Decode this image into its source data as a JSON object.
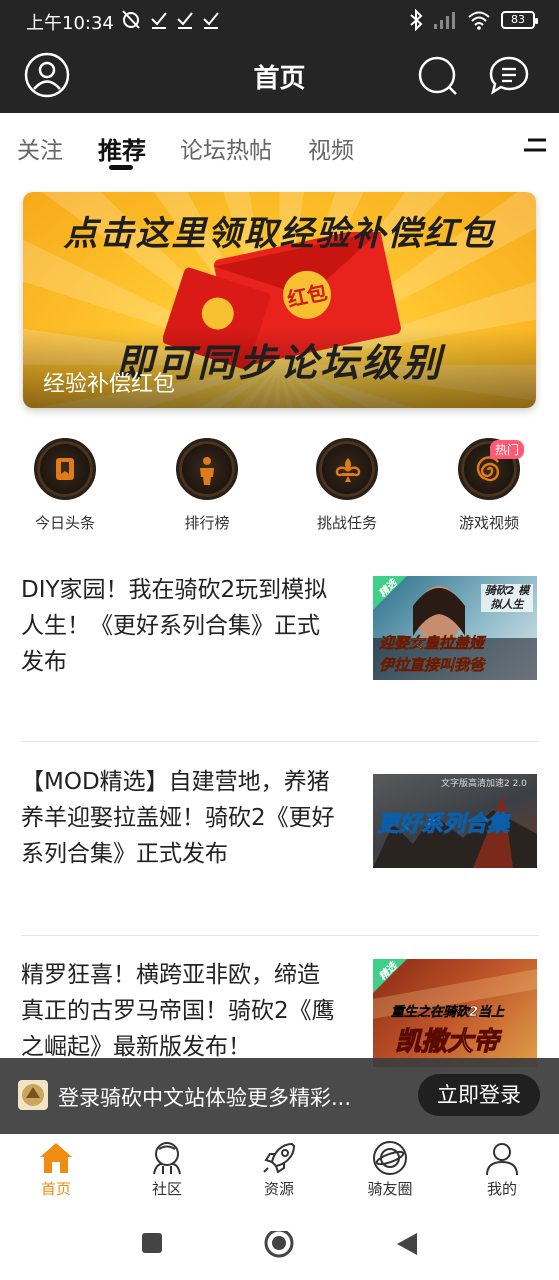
{
  "status_bar": {
    "time": "上午10:34",
    "battery": "83"
  },
  "header": {
    "title": "首页"
  },
  "tabs": [
    {
      "label": "关注",
      "active": false
    },
    {
      "label": "推荐",
      "active": true
    },
    {
      "label": "论坛热帖",
      "active": false
    },
    {
      "label": "视频",
      "active": false
    }
  ],
  "banner": {
    "line1": "点击这里领取经验补偿红包",
    "envelope_text": "红包",
    "line2": "即可同步论坛级别",
    "caption": "经验补偿红包"
  },
  "quick_links": [
    {
      "label": "今日头条",
      "icon": "bookmark-icon"
    },
    {
      "label": "排行榜",
      "icon": "person-icon"
    },
    {
      "label": "挑战任务",
      "icon": "fleur-de-lis-icon"
    },
    {
      "label": "游戏视频",
      "icon": "swirl-icon",
      "badge": "热门"
    }
  ],
  "articles": [
    {
      "title": "DIY家园！我在骑砍2玩到模拟人生！《更好系列合集》正式发布",
      "thumb_tag": "精选",
      "thumb_corner": "骑砍2 模拟人生",
      "thumb_caption_1": "迎娶女皇拉盖娅",
      "thumb_caption_2": "伊拉直接叫我爸"
    },
    {
      "title": "【MOD精选】自建营地，养猪养羊迎娶拉盖娅！骑砍2《更好系列合集》正式发布",
      "thumb_corner": "文字版高清加速2 2.0",
      "thumb_caption": "更好系列合集"
    },
    {
      "title": "精罗狂喜！横跨亚非欧，缔造真正的古罗马帝国！骑砍2《鹰之崛起》最新版发布！",
      "thumb_tag": "精选",
      "thumb_caption_1": "重生之在骑砍2当上",
      "thumb_caption_2": "凯撒大帝"
    }
  ],
  "login_prompt": {
    "text": "登录骑砍中文站体验更多精彩...",
    "button": "立即登录"
  },
  "bottom_nav": [
    {
      "label": "首页",
      "icon": "home-icon",
      "active": true
    },
    {
      "label": "社区",
      "icon": "community-icon",
      "active": false
    },
    {
      "label": "资源",
      "icon": "rocket-icon",
      "active": false
    },
    {
      "label": "骑友圈",
      "icon": "planet-icon",
      "active": false
    },
    {
      "label": "我的",
      "icon": "user-icon",
      "active": false
    }
  ],
  "colors": {
    "header_bg": "#252525",
    "accent": "#f08c12",
    "badge": "#ff5a73"
  }
}
